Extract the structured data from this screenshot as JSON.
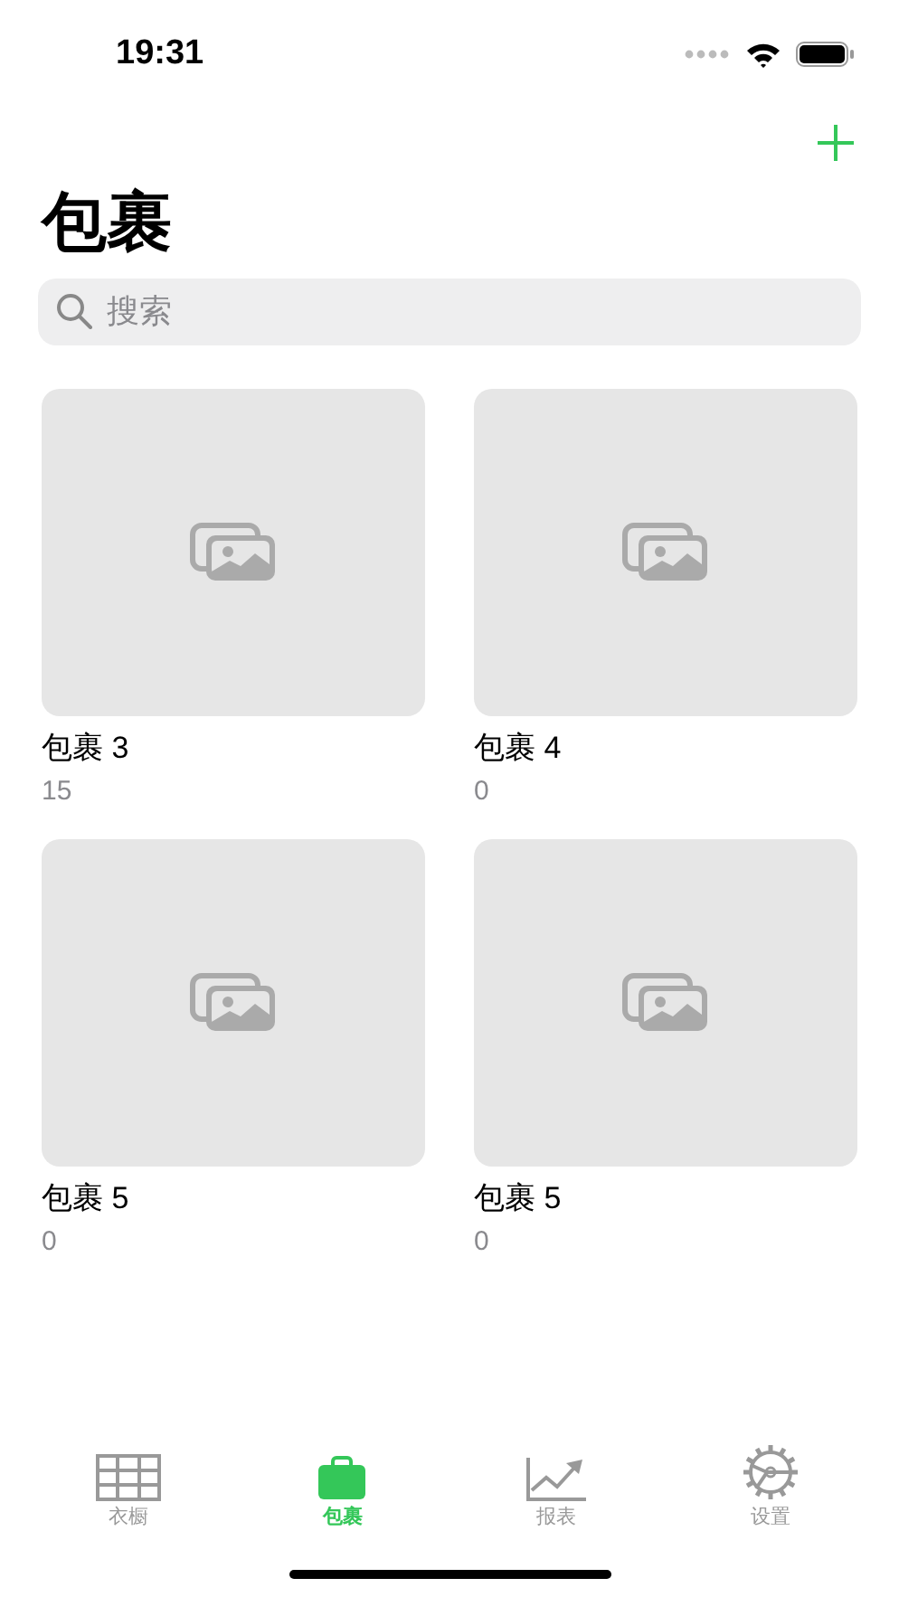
{
  "status_bar": {
    "time": "19:31"
  },
  "nav": {
    "title": "包裹"
  },
  "search": {
    "placeholder": "搜索"
  },
  "packages": [
    {
      "name": "包裹 3",
      "count": "15"
    },
    {
      "name": "包裹 4",
      "count": "0"
    },
    {
      "name": "包裹 5",
      "count": "0"
    },
    {
      "name": "包裹 5",
      "count": "0"
    }
  ],
  "tabs": [
    {
      "label": "衣橱",
      "kind": "wardrobe",
      "selected": false
    },
    {
      "label": "包裹",
      "kind": "bag",
      "selected": true
    },
    {
      "label": "报表",
      "kind": "chart",
      "selected": false
    },
    {
      "label": "设置",
      "kind": "gear",
      "selected": false
    }
  ]
}
